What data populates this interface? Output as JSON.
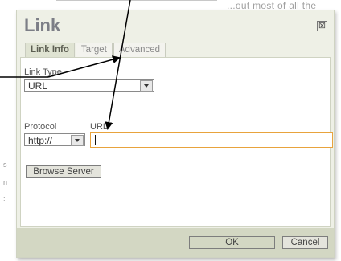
{
  "background": {
    "text": "...out most of all the"
  },
  "dialog": {
    "title": "Link",
    "close_glyph": "⊠",
    "tabs": [
      {
        "label": "Link Info",
        "active": true
      },
      {
        "label": "Target",
        "active": false
      },
      {
        "label": "Advanced",
        "active": false
      }
    ],
    "link_type_label": "Link Type",
    "link_type_value": "URL",
    "protocol_label": "Protocol",
    "protocol_value": "http://",
    "url_label": "URL",
    "url_value": "",
    "browse_label": "Browse Server",
    "ok_label": "OK",
    "cancel_label": "Cancel"
  },
  "colors": {
    "dialog_bg": "#eef0e6",
    "bottom_bar": "#d3d7c3",
    "url_focus_border": "#e8a33d",
    "title": "#7c7e86"
  }
}
